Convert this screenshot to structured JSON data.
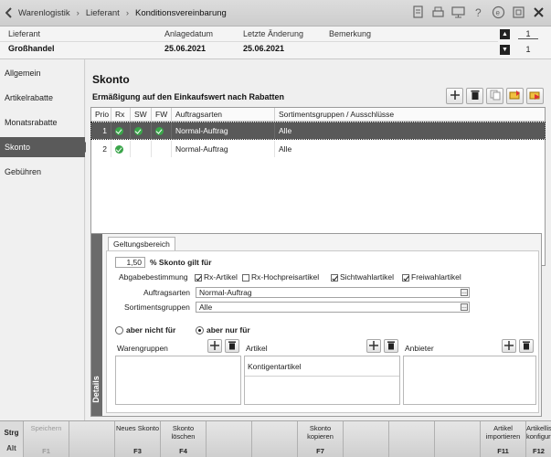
{
  "breadcrumb": {
    "items": [
      "Warenlogistik",
      "Lieferant",
      "Konditionsvereinbarung"
    ]
  },
  "title_icons": [
    "document-icon",
    "printer-icon",
    "monitor-icon",
    "help-icon",
    "circle-e-icon",
    "window-icon",
    "close-icon"
  ],
  "header": {
    "labels": {
      "lieferant": "Lieferant",
      "anlagedatum": "Anlagedatum",
      "aenderung": "Letzte Änderung",
      "bemerkung": "Bemerkung"
    },
    "values": {
      "lieferant": "Großhandel",
      "anlagedatum": "25.06.2021",
      "aenderung": "25.06.2021",
      "bemerkung": ""
    },
    "pager": {
      "current": "1",
      "total": "1"
    }
  },
  "sidebar": {
    "items": [
      {
        "label": "Allgemein",
        "active": false
      },
      {
        "label": "Artikelrabatte",
        "active": false
      },
      {
        "label": "Monatsrabatte",
        "active": false
      },
      {
        "label": "Skonto",
        "active": true
      },
      {
        "label": "Gebühren",
        "active": false
      }
    ]
  },
  "main": {
    "title": "Skonto",
    "subtitle": "Ermäßigung auf den Einkaufswert nach Rabatten"
  },
  "grid": {
    "columns": [
      "Prio",
      "Rx",
      "SW",
      "FW",
      "Auftragsarten",
      "Sortimentsgruppen / Ausschlüsse"
    ],
    "rows": [
      {
        "prio": "1",
        "rx": true,
        "sw": true,
        "fw": true,
        "auftragsart": "Normal-Auftrag",
        "sortiment": "Alle",
        "selected": true
      },
      {
        "prio": "2",
        "rx": true,
        "sw": false,
        "fw": false,
        "auftragsart": "Normal-Auftrag",
        "sortiment": "Alle",
        "selected": false
      }
    ]
  },
  "details": {
    "side_label": "Details",
    "tab": "Geltungsbereich",
    "skonto_value": "1,50",
    "skonto_label": "% Skonto gilt für",
    "abgabe_label": "Abgabebestimmung",
    "checkboxes": [
      {
        "label": "Rx-Artikel",
        "checked": true
      },
      {
        "label": "Rx-Hochpreisartikel",
        "checked": false
      },
      {
        "label": "Sichtwahlartikel",
        "checked": true
      },
      {
        "label": "Freiwahlartikel",
        "checked": true
      }
    ],
    "auftragsarten_label": "Auftragsarten",
    "auftragsarten_value": "Normal-Auftrag",
    "sortiment_label": "Sortimentsgruppen",
    "sortiment_value": "Alle",
    "radio_not": "aber nicht für",
    "radio_only": "aber nur für",
    "radio_selected": "only",
    "warengruppen_label": "Warengruppen",
    "artikel_label": "Artikel",
    "anbieter_label": "Anbieter",
    "artikel_items": [
      "Kontigentartikel"
    ]
  },
  "fbar": {
    "mod_top": "Strg",
    "mod_bottom": "Alt",
    "keys": [
      {
        "label": "Speichern",
        "key": "F1",
        "disabled": true
      },
      {
        "label": "",
        "key": "",
        "disabled": true
      },
      {
        "label": "Neues Skonto",
        "key": "F3",
        "disabled": false
      },
      {
        "label": "Skonto löschen",
        "key": "F4",
        "disabled": false
      },
      {
        "label": "",
        "key": "",
        "disabled": true
      },
      {
        "label": "",
        "key": "",
        "disabled": true
      },
      {
        "label": "Skonto kopieren",
        "key": "F7",
        "disabled": false
      },
      {
        "label": "",
        "key": "",
        "disabled": true
      },
      {
        "label": "",
        "key": "",
        "disabled": true
      },
      {
        "label": "",
        "key": "",
        "disabled": true
      },
      {
        "label": "Artikel importieren",
        "key": "F11",
        "disabled": false
      },
      {
        "label": "Artikellisten konfigurieren",
        "key": "F12",
        "disabled": false
      }
    ]
  },
  "colors": {
    "selected_row": "#595959",
    "check_green": "#3aa54a",
    "sidebar_active": "#5a5a5a"
  }
}
